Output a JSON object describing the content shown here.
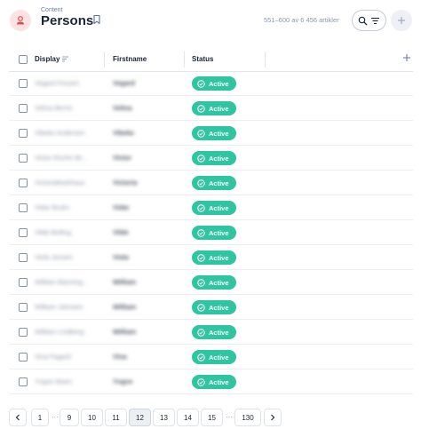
{
  "header": {
    "breadcrumb": "Content",
    "title": "Persons",
    "count": "551–600 av 6 456 artikler"
  },
  "table": {
    "columns": [
      "Display",
      "Firstname",
      "Status"
    ],
    "rows": [
      {
        "display": "Vegard Fossen",
        "firstname": "Vegard",
        "status": "Active"
      },
      {
        "display": "Velina Berrio",
        "firstname": "Velina",
        "status": "Active"
      },
      {
        "display": "Vibeke Andersen",
        "firstname": "Vibeke",
        "status": "Active"
      },
      {
        "display": "Victor Roche de...",
        "firstname": "Victor",
        "status": "Active"
      },
      {
        "display": "VictoriaBarkhaus",
        "firstname": "Victoria",
        "status": "Active"
      },
      {
        "display": "Vidar Bruhn",
        "firstname": "Vidar",
        "status": "Active"
      },
      {
        "display": "Vilde Bolling",
        "firstname": "Vilde",
        "status": "Active"
      },
      {
        "display": "Viola Jonsen",
        "firstname": "Viola",
        "status": "Active"
      },
      {
        "display": "William Banning...",
        "firstname": "William",
        "status": "Active"
      },
      {
        "display": "William Johnsen",
        "firstname": "William",
        "status": "Active"
      },
      {
        "display": "William Lindberg",
        "firstname": "William",
        "status": "Active"
      },
      {
        "display": "Vina Fagard",
        "firstname": "Vina",
        "status": "Active"
      },
      {
        "display": "Yngve Moen",
        "firstname": "Yngve",
        "status": "Active"
      }
    ]
  },
  "pagination": {
    "prev": "‹",
    "next": "›",
    "ellipsis": "···",
    "pages": [
      "1",
      "9",
      "10",
      "11",
      "12",
      "13",
      "14",
      "15",
      "130"
    ],
    "current": "12"
  },
  "icons": [
    "person-icon",
    "bookmark-icon",
    "search-icon",
    "filter-icon",
    "plus-icon",
    "sort-icon",
    "check-circle-icon",
    "chevron-left-icon",
    "chevron-right-icon"
  ],
  "colors": {
    "accent_red": "#e0484e",
    "active_badge": "#2fc5a0",
    "text_dark": "#1a2536",
    "muted": "#8a96b4"
  }
}
